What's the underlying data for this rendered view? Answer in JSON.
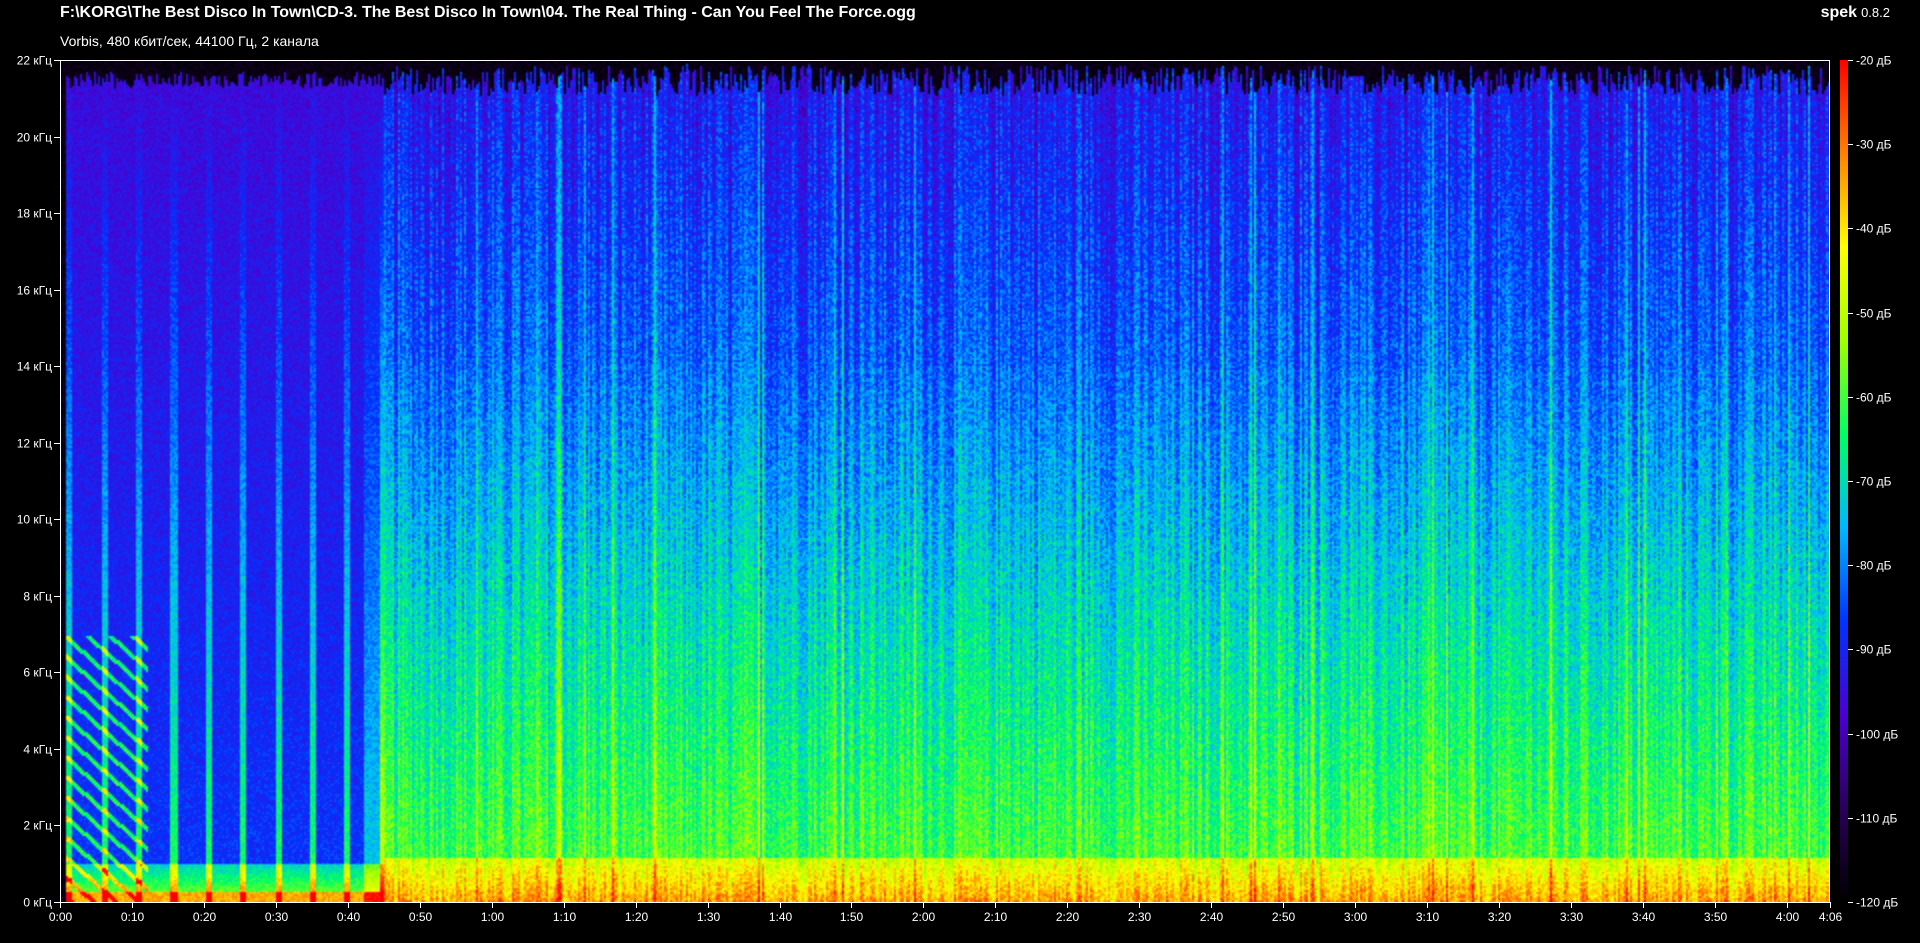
{
  "header": {
    "file_path": "F:\\KORG\\The Best Disco In Town\\CD-3. The Best Disco In Town\\04. The Real Thing - Can You Feel The Force.ogg",
    "file_info": "Vorbis, 480 кбит/сек, 44100 Гц, 2 канала",
    "app_name": "spek",
    "app_version": "0.8.2"
  },
  "colors": {
    "background": "#000000",
    "text": "#ffffff",
    "colormap": [
      "#000000",
      "#2a005a",
      "#4b00d0",
      "#0033ff",
      "#00b8ff",
      "#00ff64",
      "#a0ff00",
      "#ffff00",
      "#ff8000",
      "#ff0000"
    ]
  },
  "chart_data": {
    "type": "heatmap",
    "x_unit": "time (m:ss)",
    "y_unit": "frequency (кГц)",
    "duration_seconds": 246,
    "xlim": [
      0,
      246
    ],
    "ylim": [
      0,
      22
    ],
    "x_ticks": [
      {
        "value": 0,
        "label": "0:00"
      },
      {
        "value": 10,
        "label": "0:10"
      },
      {
        "value": 20,
        "label": "0:20"
      },
      {
        "value": 30,
        "label": "0:30"
      },
      {
        "value": 40,
        "label": "0:40"
      },
      {
        "value": 50,
        "label": "0:50"
      },
      {
        "value": 60,
        "label": "1:00"
      },
      {
        "value": 70,
        "label": "1:10"
      },
      {
        "value": 80,
        "label": "1:20"
      },
      {
        "value": 90,
        "label": "1:30"
      },
      {
        "value": 100,
        "label": "1:40"
      },
      {
        "value": 110,
        "label": "1:50"
      },
      {
        "value": 120,
        "label": "2:00"
      },
      {
        "value": 130,
        "label": "2:10"
      },
      {
        "value": 140,
        "label": "2:20"
      },
      {
        "value": 150,
        "label": "2:30"
      },
      {
        "value": 160,
        "label": "2:40"
      },
      {
        "value": 170,
        "label": "2:50"
      },
      {
        "value": 180,
        "label": "3:00"
      },
      {
        "value": 190,
        "label": "3:10"
      },
      {
        "value": 200,
        "label": "3:20"
      },
      {
        "value": 210,
        "label": "3:30"
      },
      {
        "value": 220,
        "label": "3:40"
      },
      {
        "value": 230,
        "label": "3:50"
      },
      {
        "value": 240,
        "label": "4:00"
      },
      {
        "value": 246,
        "label": "4:06"
      }
    ],
    "y_ticks": [
      {
        "value": 0,
        "label": "0 кГц"
      },
      {
        "value": 2,
        "label": "2 кГц"
      },
      {
        "value": 4,
        "label": "4 кГц"
      },
      {
        "value": 6,
        "label": "6 кГц"
      },
      {
        "value": 8,
        "label": "8 кГц"
      },
      {
        "value": 10,
        "label": "10 кГц"
      },
      {
        "value": 12,
        "label": "12 кГц"
      },
      {
        "value": 14,
        "label": "14 кГц"
      },
      {
        "value": 16,
        "label": "16 кГц"
      },
      {
        "value": 18,
        "label": "18 кГц"
      },
      {
        "value": 20,
        "label": "20 кГц"
      },
      {
        "value": 22,
        "label": "22 кГц"
      }
    ],
    "db_range": [
      -120,
      -20
    ],
    "db_ticks": [
      {
        "value": -20,
        "label": "-20 дБ"
      },
      {
        "value": -30,
        "label": "-30 дБ"
      },
      {
        "value": -40,
        "label": "-40 дБ"
      },
      {
        "value": -50,
        "label": "-50 дБ"
      },
      {
        "value": -60,
        "label": "-60 дБ"
      },
      {
        "value": -70,
        "label": "-70 дБ"
      },
      {
        "value": -80,
        "label": "-80 дБ"
      },
      {
        "value": -90,
        "label": "-90 дБ"
      },
      {
        "value": -100,
        "label": "-100 дБ"
      },
      {
        "value": -110,
        "label": "-110 дБ"
      },
      {
        "value": -120,
        "label": "-120 дБ"
      }
    ]
  }
}
